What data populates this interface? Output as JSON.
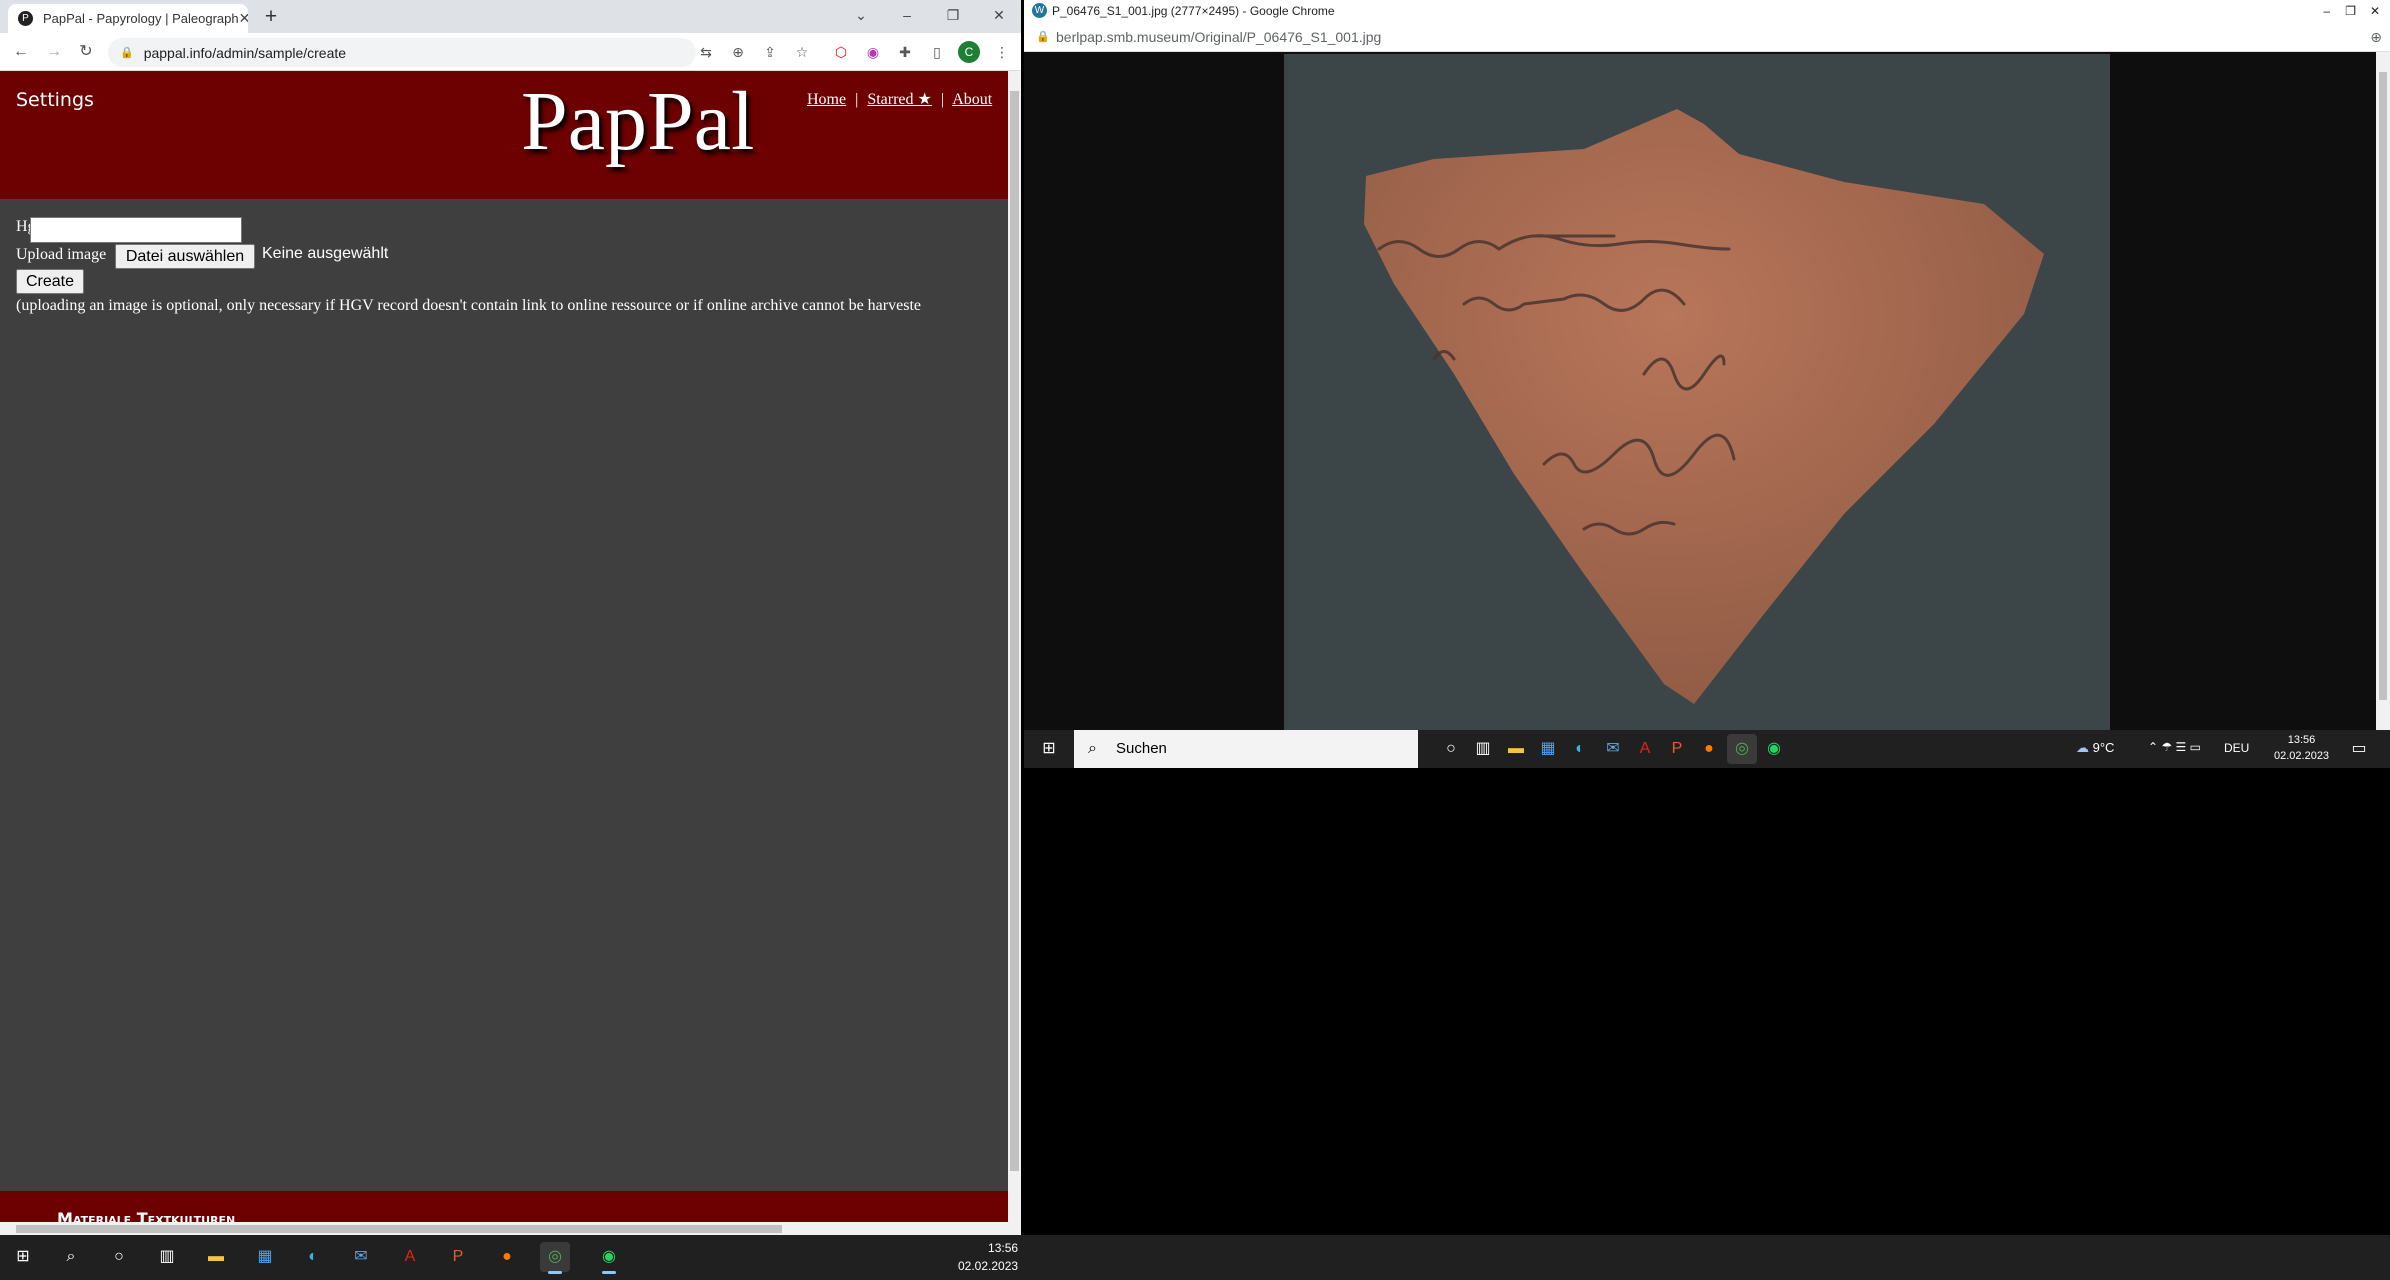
{
  "left_browser": {
    "tab_title": "PapPal - Papyrology | Paleograph",
    "url": "pappal.info/admin/sample/create",
    "page": {
      "settings_label": "Settings",
      "logo": "PapPal",
      "menu": {
        "home": "Home",
        "starred": "Starred ★",
        "about": "About",
        "sep": "|"
      },
      "hgv_label": "Hgv",
      "hgv_value": "",
      "upload_label": "Upload image",
      "choose_button": "Datei auswählen",
      "no_file": "Keine ausgewählt",
      "create_button": "Create",
      "note": "(uploading an image is optional, only necessary if HGV record doesn't contain link to online ressource or if online archive cannot be harveste",
      "footer_title": "Materiale Textkulturen"
    }
  },
  "right_browser": {
    "title": "P_06476_S1_001.jpg (2777×2495) - Google Chrome",
    "url": "berlpap.smb.museum/Original/P_06476_S1_001.jpg"
  },
  "taskbar": {
    "search_placeholder": "Suchen",
    "weather": "9°C",
    "language": "DEU",
    "time": "13:56",
    "date": "02.02.2023"
  },
  "colors": {
    "header": "#6d0000",
    "page_bg": "#3f3f3f"
  }
}
